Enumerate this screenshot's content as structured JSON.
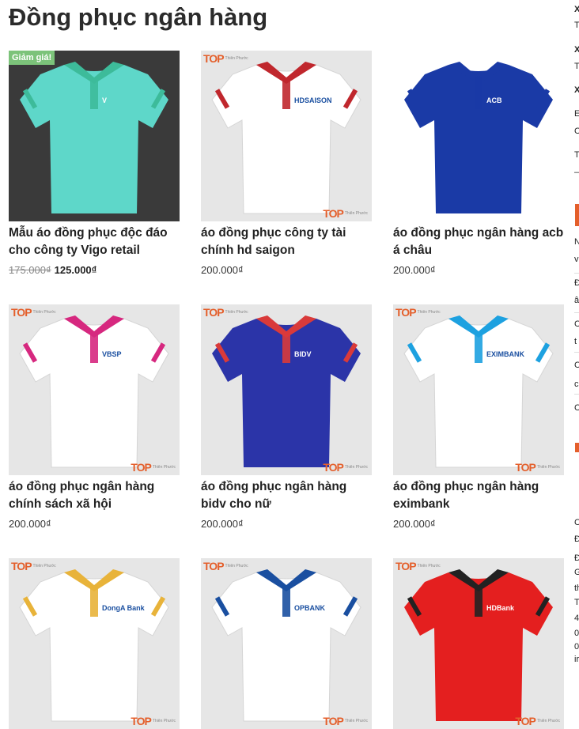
{
  "page": {
    "title": "Đồng phục ngân hàng"
  },
  "products": [
    {
      "name": "Mẫu áo đồng phục độc đáo cho công ty Vigo retail",
      "old_price": "175.000₫",
      "price": "125.000₫",
      "badge": "Giảm giá!",
      "shirt_color": "#5ed7c9",
      "collar_color": "#3dbb9a",
      "logo": "V",
      "style": "photo"
    },
    {
      "name": "áo đồng phục công ty tài chính hd saigon",
      "price": "200.000₫",
      "shirt_color": "#ffffff",
      "collar_color": "#c0272d",
      "logo": "HDSAISON",
      "brand_text": "Thiên Phước"
    },
    {
      "name": "áo đồng phục ngân hàng acb á châu",
      "price": "200.000₫",
      "shirt_color": "#1a3aa6",
      "collar_color": "#1a3aa6",
      "logo": "ACB",
      "style": "photo"
    },
    {
      "name": "áo đồng phục ngân hàng chính sách xã hội",
      "price": "200.000₫",
      "shirt_color": "#ffffff",
      "collar_color": "#d6287f",
      "logo": "VBSP",
      "brand_text": "Thiên Phước"
    },
    {
      "name": "áo đồng phục ngân hàng bidv cho nữ",
      "price": "200.000₫",
      "shirt_color": "#2b34a8",
      "collar_color": "#d93a3a",
      "logo": "BIDV",
      "brand_text": "Thiên Phước"
    },
    {
      "name": "áo đồng phục ngân hàng eximbank",
      "price": "200.000₫",
      "shirt_color": "#ffffff",
      "collar_color": "#1da1e0",
      "logo": "EXIMBANK",
      "brand_text": "Thiên Phước"
    },
    {
      "name": "",
      "price": "",
      "shirt_color": "#ffffff",
      "collar_color": "#e8b33a",
      "logo": "DongA Bank",
      "brand_text": "Thiên Phước"
    },
    {
      "name": "",
      "price": "",
      "shirt_color": "#ffffff",
      "collar_color": "#1a4fa0",
      "logo": "OPBANK",
      "brand_text": "Thiên Phước"
    },
    {
      "name": "",
      "price": "",
      "shirt_color": "#e41f1f",
      "collar_color": "#222222",
      "logo": "HDBank",
      "brand_text": "Thiên Phước"
    }
  ],
  "brand_mark": "TOP",
  "sidebar": {
    "fragments": [
      "X",
      "T",
      "X",
      "T",
      "X",
      "E",
      "C",
      "T",
      "–",
      "N",
      "v",
      "Đ",
      "â",
      "C",
      "t",
      "C",
      "c",
      "C",
      "C",
      "Đ",
      "Đ",
      "G",
      "th",
      "T",
      "4",
      "0",
      "0",
      "ir"
    ]
  },
  "colors": {
    "accent": "#e45f2b",
    "sale": "#7cc37a"
  }
}
